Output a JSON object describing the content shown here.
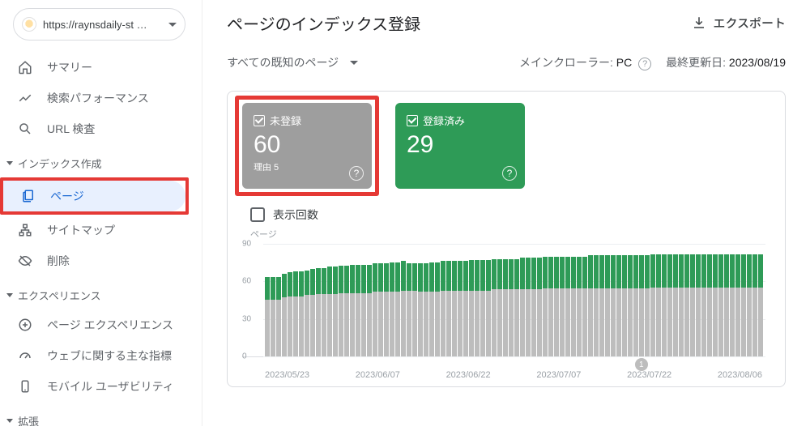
{
  "site": {
    "url": "https://raynsdaily-st …"
  },
  "sidebar": {
    "summary": "サマリー",
    "performance": "検索パフォーマンス",
    "url_inspect": "URL 検査",
    "section_index": "インデックス作成",
    "pages": "ページ",
    "sitemap": "サイトマップ",
    "removal": "削除",
    "section_exp": "エクスペリエンス",
    "page_exp": "ページ エクスペリエンス",
    "cwv": "ウェブに関する主な指標",
    "mobile": "モバイル ユーザビリティ",
    "section_ext": "拡張"
  },
  "header": {
    "title": "ページのインデックス登録",
    "export": "エクスポート"
  },
  "filter": {
    "label": "すべての既知のページ",
    "crawler_label": "メインクローラー: ",
    "crawler_value": "PC",
    "updated_label": "最終更新日: ",
    "updated_value": "2023/08/19"
  },
  "tiles": {
    "not_indexed": {
      "label": "未登録",
      "value": "60",
      "reason": "理由 5"
    },
    "indexed": {
      "label": "登録済み",
      "value": "29"
    }
  },
  "impressions_label": "表示回数",
  "chart_data": {
    "type": "bar",
    "ylabel": "ページ",
    "ylim": [
      0,
      90
    ],
    "yticks": [
      0,
      30,
      60,
      90
    ],
    "x_ticks": [
      "2023/05/23",
      "2023/06/07",
      "2023/06/22",
      "2023/07/07",
      "2023/07/22",
      "2023/08/06"
    ],
    "series_names": [
      "未登録",
      "登録済み"
    ],
    "annotation_index": 66,
    "annotation_text": "1",
    "points": [
      {
        "n": 50,
        "i": 20
      },
      {
        "n": 50,
        "i": 20
      },
      {
        "n": 50,
        "i": 20
      },
      {
        "n": 52,
        "i": 21
      },
      {
        "n": 53,
        "i": 21
      },
      {
        "n": 53,
        "i": 22
      },
      {
        "n": 53,
        "i": 22
      },
      {
        "n": 54,
        "i": 22
      },
      {
        "n": 54,
        "i": 23
      },
      {
        "n": 55,
        "i": 23
      },
      {
        "n": 55,
        "i": 23
      },
      {
        "n": 55,
        "i": 24
      },
      {
        "n": 55,
        "i": 24
      },
      {
        "n": 56,
        "i": 24
      },
      {
        "n": 56,
        "i": 24
      },
      {
        "n": 56,
        "i": 25
      },
      {
        "n": 56,
        "i": 25
      },
      {
        "n": 56,
        "i": 25
      },
      {
        "n": 56,
        "i": 25
      },
      {
        "n": 57,
        "i": 25
      },
      {
        "n": 57,
        "i": 25
      },
      {
        "n": 57,
        "i": 25
      },
      {
        "n": 57,
        "i": 26
      },
      {
        "n": 57,
        "i": 26
      },
      {
        "n": 58,
        "i": 26
      },
      {
        "n": 58,
        "i": 24
      },
      {
        "n": 58,
        "i": 24
      },
      {
        "n": 57,
        "i": 25
      },
      {
        "n": 57,
        "i": 25
      },
      {
        "n": 57,
        "i": 26
      },
      {
        "n": 57,
        "i": 26
      },
      {
        "n": 58,
        "i": 26
      },
      {
        "n": 58,
        "i": 26
      },
      {
        "n": 58,
        "i": 26
      },
      {
        "n": 58,
        "i": 26
      },
      {
        "n": 58,
        "i": 26
      },
      {
        "n": 58,
        "i": 27
      },
      {
        "n": 58,
        "i": 27
      },
      {
        "n": 58,
        "i": 27
      },
      {
        "n": 58,
        "i": 27
      },
      {
        "n": 59,
        "i": 27
      },
      {
        "n": 59,
        "i": 27
      },
      {
        "n": 59,
        "i": 27
      },
      {
        "n": 59,
        "i": 27
      },
      {
        "n": 59,
        "i": 27
      },
      {
        "n": 59,
        "i": 28
      },
      {
        "n": 59,
        "i": 28
      },
      {
        "n": 59,
        "i": 28
      },
      {
        "n": 59,
        "i": 28
      },
      {
        "n": 60,
        "i": 28
      },
      {
        "n": 60,
        "i": 28
      },
      {
        "n": 60,
        "i": 28
      },
      {
        "n": 60,
        "i": 28
      },
      {
        "n": 60,
        "i": 28
      },
      {
        "n": 60,
        "i": 28
      },
      {
        "n": 60,
        "i": 28
      },
      {
        "n": 60,
        "i": 28
      },
      {
        "n": 60,
        "i": 29
      },
      {
        "n": 60,
        "i": 29
      },
      {
        "n": 60,
        "i": 29
      },
      {
        "n": 60,
        "i": 29
      },
      {
        "n": 60,
        "i": 29
      },
      {
        "n": 60,
        "i": 29
      },
      {
        "n": 60,
        "i": 29
      },
      {
        "n": 60,
        "i": 29
      },
      {
        "n": 60,
        "i": 29
      },
      {
        "n": 60,
        "i": 29
      },
      {
        "n": 60,
        "i": 29
      },
      {
        "n": 61,
        "i": 29
      },
      {
        "n": 61,
        "i": 29
      },
      {
        "n": 61,
        "i": 29
      },
      {
        "n": 61,
        "i": 29
      },
      {
        "n": 61,
        "i": 29
      },
      {
        "n": 61,
        "i": 29
      },
      {
        "n": 61,
        "i": 29
      },
      {
        "n": 61,
        "i": 29
      },
      {
        "n": 61,
        "i": 29
      },
      {
        "n": 61,
        "i": 29
      },
      {
        "n": 61,
        "i": 29
      },
      {
        "n": 61,
        "i": 29
      },
      {
        "n": 61,
        "i": 29
      },
      {
        "n": 61,
        "i": 29
      },
      {
        "n": 61,
        "i": 29
      },
      {
        "n": 61,
        "i": 29
      },
      {
        "n": 61,
        "i": 29
      },
      {
        "n": 61,
        "i": 29
      },
      {
        "n": 61,
        "i": 29
      },
      {
        "n": 61,
        "i": 29
      }
    ]
  }
}
